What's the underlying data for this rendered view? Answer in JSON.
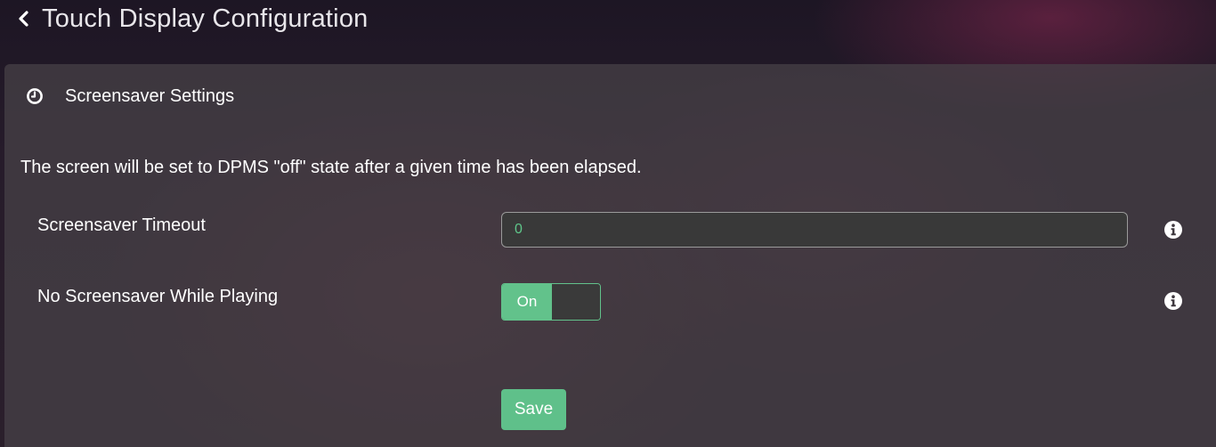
{
  "header": {
    "back_icon": "chevron-left-icon",
    "title": "Touch Display Configuration"
  },
  "panel": {
    "icon": "clock-icon",
    "title": "Screensaver Settings",
    "description": "The screen will be set to DPMS \"off\" state after a given time has been elapsed.",
    "fields": {
      "timeout": {
        "label": "Screensaver Timeout",
        "value": "0",
        "info_icon": "info-icon"
      },
      "no_screensaver_playing": {
        "label": "No Screensaver While Playing",
        "toggle_label": "On",
        "state": "on",
        "info_icon": "info-icon"
      }
    },
    "save_label": "Save"
  },
  "colors": {
    "accent": "#62c28b",
    "input_text": "#5fc78a",
    "panel_bg": "#484248"
  }
}
